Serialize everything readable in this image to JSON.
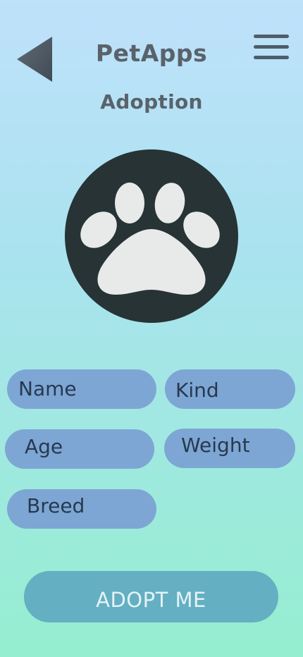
{
  "header": {
    "title": "PetApps",
    "subtitle": "Adoption",
    "back_icon": "back-triangle-icon",
    "menu_icon": "hamburger-menu-icon"
  },
  "avatar": {
    "icon": "paw-print-icon"
  },
  "form": {
    "fields": [
      {
        "label": "Name"
      },
      {
        "label": "Kind"
      },
      {
        "label": "Age"
      },
      {
        "label": "Weight"
      },
      {
        "label": "Breed"
      }
    ]
  },
  "actions": {
    "adopt_label": "ADOPT ME"
  },
  "colors": {
    "background_top": "#bfe1fb",
    "background_bottom": "#95eed0",
    "field_fill": "#7da6d4",
    "field_text": "#27394f",
    "button_fill": "#64afc2",
    "button_text": "#e3f3f7",
    "title_text": "#59626b",
    "avatar_circle": "#273335",
    "paw_fill": "#e8eaea"
  }
}
